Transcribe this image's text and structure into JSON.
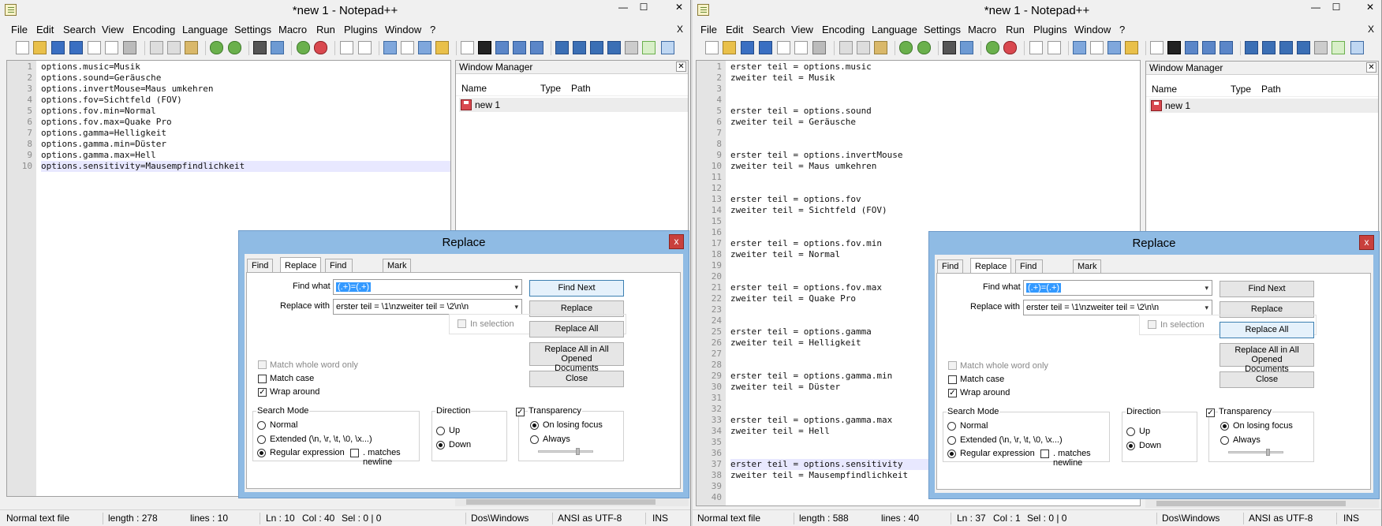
{
  "left": {
    "title": "*new  1 - Notepad++",
    "window_controls": {
      "minimize": "—",
      "maximize": "☐",
      "close": "✕"
    },
    "menu": [
      "File",
      "Edit",
      "Search",
      "View",
      "Encoding",
      "Language",
      "Settings",
      "Macro",
      "Run",
      "Plugins",
      "Window",
      "?"
    ],
    "menu_close": "X",
    "lines": [
      "options.music=Musik",
      "options.sound=Geräusche",
      "options.invertMouse=Maus umkehren",
      "options.fov=Sichtfeld (FOV)",
      "options.fov.min=Normal",
      "options.fov.max=Quake Pro",
      "options.gamma=Helligkeit",
      "options.gamma.min=Düster",
      "options.gamma.max=Hell",
      "options.sensitivity=Mausempfindlichkeit"
    ],
    "line_numbers": [
      "1",
      "2",
      "3",
      "4",
      "5",
      "6",
      "7",
      "8",
      "9",
      "10"
    ],
    "status": {
      "type": "Normal text file",
      "length": "length : 278",
      "lines": "lines : 10",
      "ln": "Ln : 10",
      "col": "Col : 40",
      "sel": "Sel : 0 | 0",
      "eol": "Dos\\Windows",
      "enc": "ANSI as UTF-8",
      "ins": "INS"
    }
  },
  "right": {
    "title": "*new  1 - Notepad++",
    "window_controls": {
      "minimize": "—",
      "maximize": "☐",
      "close": "✕"
    },
    "menu": [
      "File",
      "Edit",
      "Search",
      "View",
      "Encoding",
      "Language",
      "Settings",
      "Macro",
      "Run",
      "Plugins",
      "Window",
      "?"
    ],
    "menu_close": "X",
    "lines": [
      "erster teil = options.music",
      "zweiter teil = Musik",
      "",
      "",
      "erster teil = options.sound",
      "zweiter teil = Geräusche",
      "",
      "",
      "erster teil = options.invertMouse",
      "zweiter teil = Maus umkehren",
      "",
      "",
      "erster teil = options.fov",
      "zweiter teil = Sichtfeld (FOV)",
      "",
      "",
      "erster teil = options.fov.min",
      "zweiter teil = Normal",
      "",
      "",
      "erster teil = options.fov.max",
      "zweiter teil = Quake Pro",
      "",
      "",
      "erster teil = options.gamma",
      "zweiter teil = Helligkeit",
      "",
      "",
      "erster teil = options.gamma.min",
      "zweiter teil = Düster",
      "",
      "",
      "erster teil = options.gamma.max",
      "zweiter teil = Hell",
      "",
      "",
      "erster teil = options.sensitivity",
      "zweiter teil = Mausempfindlichkeit",
      "",
      ""
    ],
    "line_numbers": [
      "1",
      "2",
      "3",
      "4",
      "5",
      "6",
      "7",
      "8",
      "9",
      "10",
      "11",
      "12",
      "13",
      "14",
      "15",
      "16",
      "17",
      "18",
      "19",
      "20",
      "21",
      "22",
      "23",
      "24",
      "25",
      "26",
      "27",
      "28",
      "29",
      "30",
      "31",
      "32",
      "33",
      "34",
      "35",
      "36",
      "37",
      "38",
      "39",
      "40"
    ],
    "status": {
      "type": "Normal text file",
      "length": "length : 588",
      "lines": "lines : 40",
      "ln": "Ln : 37",
      "col": "Col : 1",
      "sel": "Sel : 0 | 0",
      "eol": "Dos\\Windows",
      "enc": "ANSI as UTF-8",
      "ins": "INS"
    }
  },
  "window_manager": {
    "title": "Window Manager",
    "close": "✕",
    "col_name": "Name",
    "col_type": "Type",
    "col_path": "Path",
    "file": "new  1"
  },
  "dialog": {
    "title": "Replace",
    "close": "x",
    "tabs": [
      "Find",
      "Replace",
      "Find in Files",
      "Mark"
    ],
    "find_label": "Find what :",
    "find_value": "(.+)=(.+)",
    "replace_label": "Replace with :",
    "replace_value": "erster teil = \\1\\nzweiter teil = \\2\\n\\n",
    "in_selection": "In selection",
    "find_next": "Find Next",
    "replace": "Replace",
    "replace_all": "Replace All",
    "replace_all_opened_1": "Replace All in All Opened",
    "replace_all_opened_2": "Documents",
    "close_btn": "Close",
    "match_whole": "Match whole word only",
    "match_case": "Match case",
    "wrap_around": "Wrap around",
    "search_mode": "Search Mode",
    "mode_normal": "Normal",
    "mode_extended": "Extended (\\n, \\r, \\t, \\0, \\x...)",
    "mode_regex": "Regular expression",
    "dot_newline": ". matches newline",
    "direction": "Direction",
    "dir_up": "Up",
    "dir_down": "Down",
    "transparency": "Transparency",
    "on_losing_focus": "On losing focus",
    "always": "Always",
    "check_mark": "✓",
    "dropdown_arrow": "▾"
  },
  "toolbar_icons": [
    "new-icon",
    "open-icon",
    "save-icon",
    "save-all-icon",
    "close-icon",
    "close-all-icon",
    "print-icon",
    "cut-icon",
    "copy-icon",
    "paste-icon",
    "undo-icon",
    "redo-icon",
    "find-icon",
    "replace-icon",
    "zoom-in-icon",
    "zoom-out-icon",
    "sync-v-icon",
    "sync-h-icon",
    "wrap-icon",
    "all-chars-icon",
    "indent-guide-icon",
    "record-icon",
    "stop-icon",
    "play-icon",
    "play-multiple-icon",
    "save-macro-icon",
    "spell-icon",
    "doc-map-icon"
  ],
  "colors": {
    "dialog_frame": "#8fbbe4",
    "current_line": "#e8e8ff",
    "selection": "#3399ff",
    "close_red": "#c9403c"
  }
}
